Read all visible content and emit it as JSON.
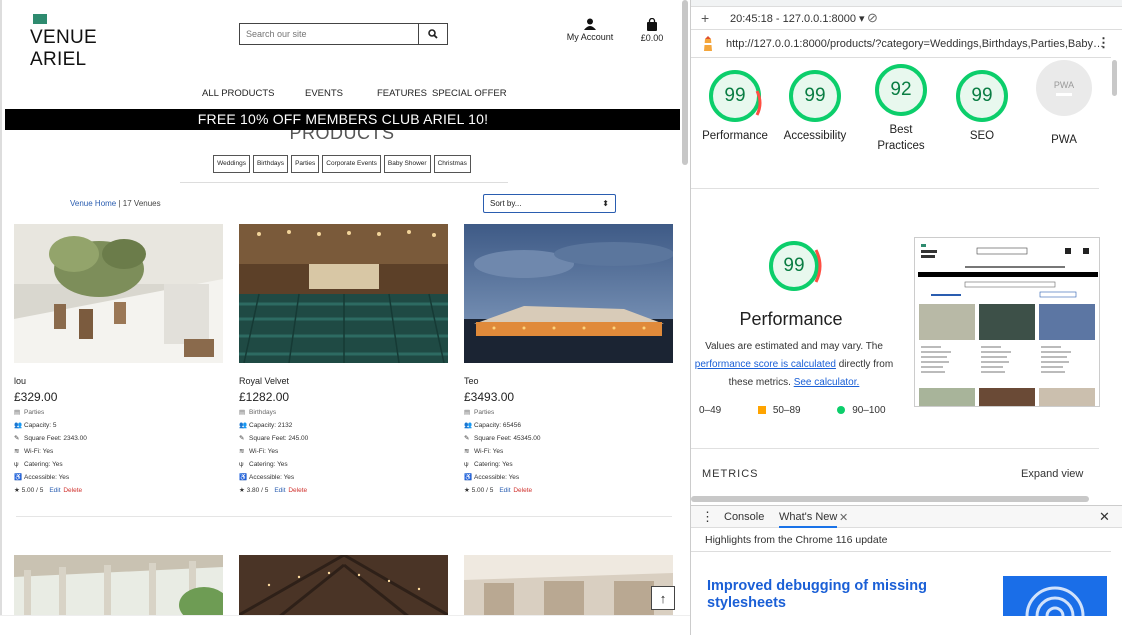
{
  "site": {
    "logo_line1": "VENUE",
    "logo_line2": "ARIEL",
    "search_placeholder": "Search our site",
    "account_label": "My Account",
    "bag_total": "£0.00",
    "nav": [
      "ALL PRODUCTS",
      "EVENTS",
      "FEATURES",
      "SPECIAL OFFER"
    ],
    "banner": "FREE 10% OFF MEMBERS CLUB ARIEL 10!",
    "page_title": "PRODUCTS",
    "categories": [
      "Weddings",
      "Birthdays",
      "Parties",
      "Corporate Events",
      "Baby Shower",
      "Christmas"
    ],
    "breadcrumb_link": "Venue Home",
    "breadcrumb_sep": " | ",
    "breadcrumb_count": "17 Venues",
    "sort_label": "Sort by...",
    "cards": [
      {
        "name": "lou",
        "price": "£329.00",
        "category": "Parties",
        "capacity": "Capacity: 5",
        "sqft": "Square Feet: 2343.00",
        "wifi": "Wi-Fi: Yes",
        "catering": "Catering: Yes",
        "accessible": "Accessible: Yes",
        "rating": "5.00 / 5",
        "edit": "Edit",
        "delete": "Delete"
      },
      {
        "name": "Royal Velvet",
        "price": "£1282.00",
        "category": "Birthdays",
        "capacity": "Capacity: 2132",
        "sqft": "Square Feet: 245.00",
        "wifi": "Wi-Fi: Yes",
        "catering": "Catering: Yes",
        "accessible": "Accessible: Yes",
        "rating": "3.80 / 5",
        "edit": "Edit",
        "delete": "Delete"
      },
      {
        "name": "Teo",
        "price": "£3493.00",
        "category": "Parties",
        "capacity": "Capacity: 65456",
        "sqft": "Square Feet: 45345.00",
        "wifi": "Wi-Fi: Yes",
        "catering": "Catering: Yes",
        "accessible": "Accessible: Yes",
        "rating": "5.00 / 5",
        "edit": "Edit",
        "delete": "Delete"
      }
    ]
  },
  "devtools": {
    "timestamp": "20:45:18 - 127.0.0.1:8000 ▾",
    "url": "http://127.0.0.1:8000/products/?category=Weddings,Birthdays,Parties,Baby…",
    "scores": [
      {
        "value": "99",
        "label": "Performance"
      },
      {
        "value": "99",
        "label": "Accessibility"
      },
      {
        "value": "92",
        "label": "Best Practices"
      },
      {
        "value": "99",
        "label": "SEO"
      },
      {
        "value": "PWA",
        "label": "PWA"
      }
    ],
    "perf_score": "99",
    "perf_title": "Performance",
    "perf_desc_1": "Values are estimated and may vary. The",
    "perf_desc_link": "performance score is calculated",
    "perf_desc_2": " directly from these metrics. ",
    "perf_desc_link2": "See calculator.",
    "legend": [
      "0–49",
      "50–89",
      "90–100"
    ],
    "metrics_label": "METRICS",
    "expand_label": "Expand view",
    "drawer_tabs": [
      "Console",
      "What's New"
    ],
    "highlights": "Highlights from the Chrome 116 update",
    "article_title": "Improved debugging of missing stylesheets"
  },
  "colors": {
    "good": "#0cce6b",
    "average": "#ffa400",
    "banner": "#000000",
    "link": "#1a5fd6"
  }
}
